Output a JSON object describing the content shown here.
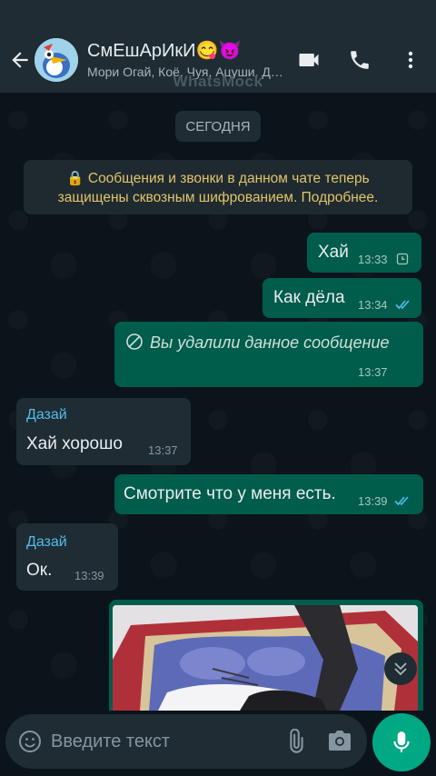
{
  "header": {
    "title": "СмЕшАрИкИ😋😈",
    "subtitle": "Мори Огай, Коё, Чуя, Ацуши, Дазай",
    "watermark": "WhatsMock"
  },
  "chat": {
    "date_chip": "СЕГОДНЯ",
    "system_message": "🔒 Сообщения и звонки в данном чате теперь защищены сквозным шифрованием. Подробнее.",
    "messages": [
      {
        "direction": "out",
        "text": "Хай",
        "time": "13:33",
        "status": "pending"
      },
      {
        "direction": "out",
        "text": "Как дёла",
        "time": "13:34",
        "status": "read"
      },
      {
        "direction": "out",
        "text": "Вы удалили данное сообщение",
        "time": "13:37",
        "status": "deleted"
      },
      {
        "direction": "in",
        "sender": "Дазай",
        "text": "Хай хорошо",
        "time": "13:37"
      },
      {
        "direction": "out",
        "text": "Смотрите что у меня есть.",
        "time": "13:39",
        "status": "read"
      },
      {
        "direction": "in",
        "sender": "Дазай",
        "text": "Ок.",
        "time": "13:39"
      },
      {
        "direction": "out",
        "type": "photo"
      }
    ]
  },
  "input": {
    "placeholder": "Введите текст"
  },
  "colors": {
    "header_bg": "#1f2c33",
    "outgoing_bubble": "#005c4b",
    "incoming_bubble": "#1f2c33",
    "accent": "#00a884",
    "sender_name": "#53bdeb",
    "system_text": "#e3c46a"
  },
  "icons": [
    "back-arrow-icon",
    "video-call-icon",
    "phone-icon",
    "more-vert-icon",
    "lock-icon",
    "clock-icon",
    "double-check-icon",
    "blocked-icon",
    "chevron-double-down-icon",
    "emoji-icon",
    "attach-icon",
    "camera-icon",
    "mic-icon"
  ]
}
